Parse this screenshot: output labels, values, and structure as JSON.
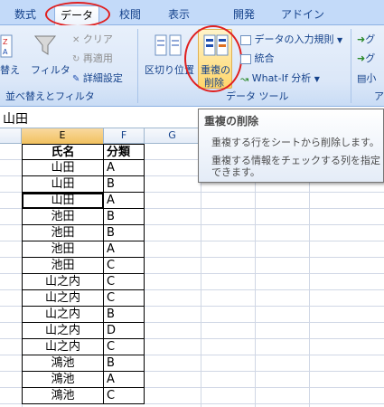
{
  "tabs": [
    {
      "label": "数式",
      "active": false
    },
    {
      "label": "データ",
      "active": true
    },
    {
      "label": "校閲",
      "active": false
    },
    {
      "label": "表示",
      "active": false
    },
    {
      "label": "開発",
      "active": false
    },
    {
      "label": "アドイン",
      "active": false
    }
  ],
  "ribbon": {
    "sort_partial_label": "替え",
    "filter_label": "フィルタ",
    "clear_label": "クリア",
    "reapply_label": "再適用",
    "advanced_label": "詳細設定",
    "sort_filter_group": "並べ替えとフィルタ",
    "text_to_columns_label": "区切り位置",
    "remove_duplicates_line1": "重複の",
    "remove_duplicates_line2": "削除",
    "data_validation_label": "データの入力規則",
    "consolidate_label": "統合",
    "whatif_label": "What-If 分析",
    "data_tools_group": "データ ツール",
    "outline_item1": "グ",
    "outline_item2": "グ",
    "outline_item3": "小",
    "outline_group_partial": "ア"
  },
  "formula_bar": {
    "value": "山田"
  },
  "columns": {
    "e": "E",
    "f": "F",
    "g": "G"
  },
  "table": {
    "headers": [
      "氏名",
      "分類"
    ],
    "rows": [
      [
        "山田",
        "A"
      ],
      [
        "山田",
        "B"
      ],
      [
        "山田",
        "A"
      ],
      [
        "池田",
        "B"
      ],
      [
        "池田",
        "B"
      ],
      [
        "池田",
        "A"
      ],
      [
        "池田",
        "C"
      ],
      [
        "山之内",
        "C"
      ],
      [
        "山之内",
        "C"
      ],
      [
        "山之内",
        "B"
      ],
      [
        "山之内",
        "D"
      ],
      [
        "山之内",
        "C"
      ],
      [
        "鴻池",
        "B"
      ],
      [
        "鴻池",
        "A"
      ],
      [
        "鴻池",
        "C"
      ]
    ]
  },
  "tooltip": {
    "title": "重複の削除",
    "line1": "重複する行をシートから削除します。",
    "line2": "重複する情報をチェックする列を指定できます。"
  },
  "colors": {
    "accent_red": "#e02020",
    "selected_col": "#f1c15f",
    "ribbon_text": "#15428b"
  }
}
